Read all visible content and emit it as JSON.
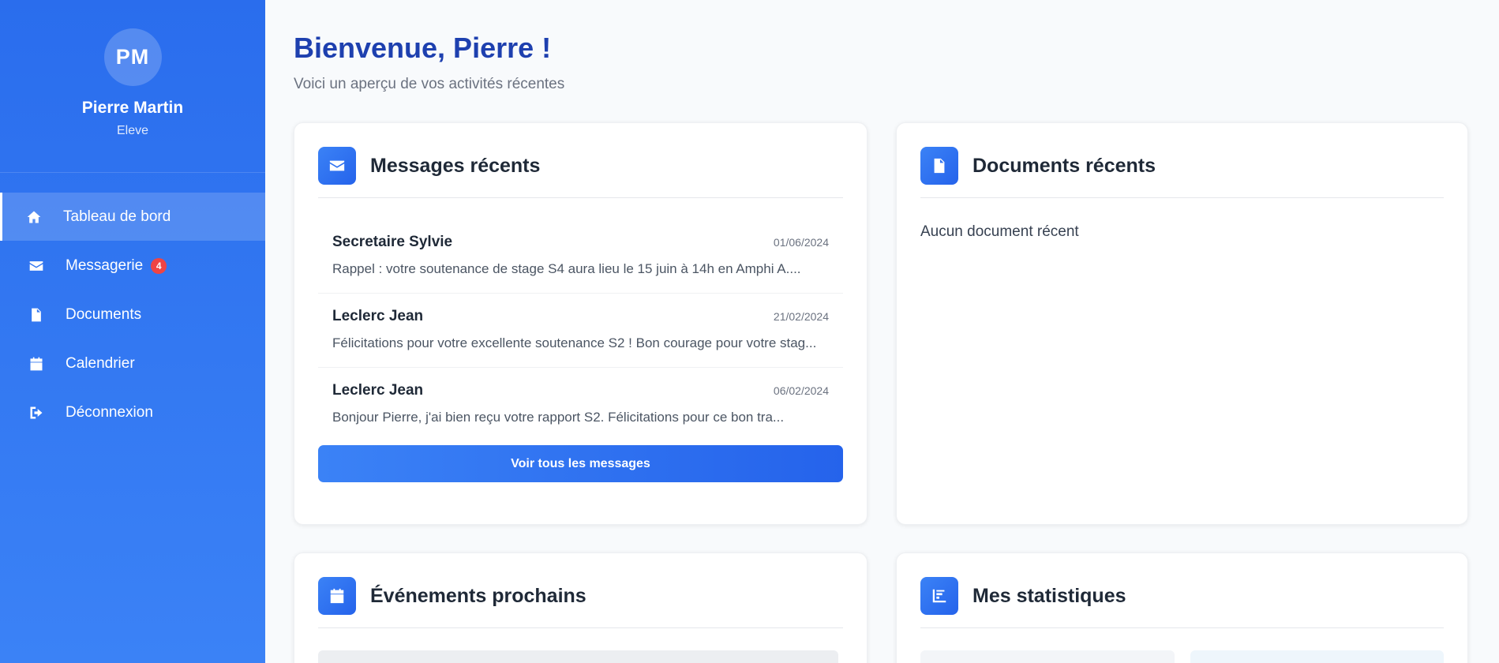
{
  "user": {
    "initials": "PM",
    "name": "Pierre Martin",
    "role": "Eleve"
  },
  "nav": [
    {
      "label": "Tableau de bord",
      "icon": "home-icon",
      "active": true
    },
    {
      "label": "Messagerie",
      "icon": "envelope-icon",
      "badge": "4"
    },
    {
      "label": "Documents",
      "icon": "document-icon"
    },
    {
      "label": "Calendrier",
      "icon": "calendar-icon"
    },
    {
      "label": "Déconnexion",
      "icon": "logout-icon"
    }
  ],
  "header": {
    "title": "Bienvenue, Pierre !",
    "subtitle": "Voici un aperçu de vos activités récentes"
  },
  "messages_card": {
    "title": "Messages récents",
    "icon": "envelope-icon",
    "items": [
      {
        "sender": "Secretaire Sylvie",
        "date": "01/06/2024",
        "preview": "Rappel : votre soutenance de stage S4 aura lieu le 15 juin à 14h en Amphi A...."
      },
      {
        "sender": "Leclerc Jean",
        "date": "21/02/2024",
        "preview": "Félicitations pour votre excellente soutenance S2 ! Bon courage pour votre stag..."
      },
      {
        "sender": "Leclerc Jean",
        "date": "06/02/2024",
        "preview": "Bonjour Pierre, j'ai bien reçu votre rapport S2. Félicitations pour ce bon tra..."
      }
    ],
    "button_label": "Voir tous les messages"
  },
  "documents_card": {
    "title": "Documents récents",
    "icon": "document-icon",
    "empty_text": "Aucun document récent"
  },
  "events_card": {
    "title": "Événements prochains",
    "icon": "calendar-icon"
  },
  "stats_card": {
    "title": "Mes statistiques",
    "icon": "chart-icon"
  },
  "colors": {
    "accent": "#2563eb",
    "title": "#1e40af",
    "badge": "#ef4444"
  }
}
